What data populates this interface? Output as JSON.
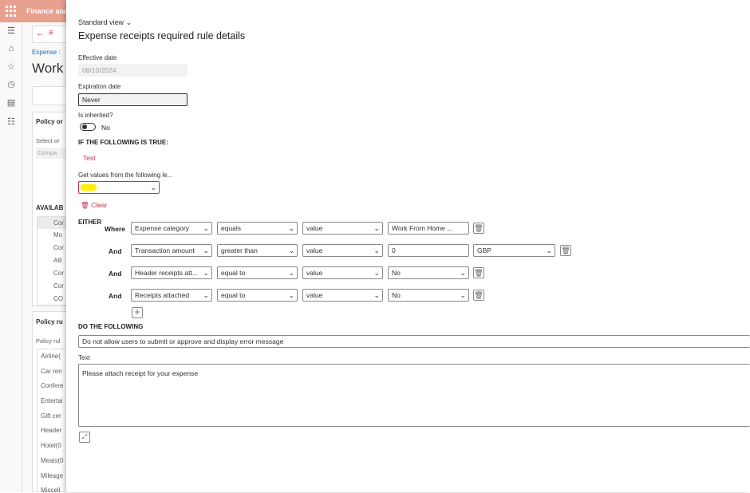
{
  "app": {
    "title": "Finance and"
  },
  "background": {
    "breadcrumb": "Expense :",
    "heading": "Work",
    "policy_org_label": "Policy or",
    "select_label": "Select or",
    "company_label": "Compa",
    "available_label": "AVAILAB",
    "available_items": [
      "Cor",
      "Mo",
      "Cor",
      "Alli",
      "Cor",
      "Cor",
      "CO"
    ],
    "policy_rules_label": "Policy ru",
    "policy_rules_sub": "Policy rul",
    "rule_items": [
      "Airline(",
      "Car ren",
      "Confere",
      "Entertai",
      "Gift cer",
      "Header",
      "Hotel(0",
      "Meals(0",
      "Mileage",
      "Miscell"
    ]
  },
  "panel": {
    "view": "Standard view",
    "title": "Expense receipts required rule details",
    "effective_date": {
      "label": "Effective date",
      "value": "08/10/2024"
    },
    "expiration_date": {
      "label": "Expiration date",
      "value": "Never"
    },
    "is_inherited": {
      "label": "Is inherited?",
      "value": "No"
    },
    "if_heading": "IF THE FOLLOWING IS TRUE:",
    "test_link": "Test",
    "get_values_label": "Get values from the following le...",
    "clear_label": "Clear",
    "either_label": "EITHER",
    "conditions": [
      {
        "conn": "Where",
        "field": "Expense category",
        "op": "equals",
        "type": "value",
        "val": "Work From Home ..."
      },
      {
        "conn": "And",
        "field": "Transaction amount",
        "op": "greater than",
        "type": "value",
        "val": "0",
        "extra": "GBP"
      },
      {
        "conn": "And",
        "field": "Header receipts att...",
        "op": "equal to",
        "type": "value",
        "val": "No"
      },
      {
        "conn": "And",
        "field": "Receipts attached",
        "op": "equal to",
        "type": "value",
        "val": "No"
      }
    ],
    "do_heading": "DO THE FOLLOWING",
    "action": "Do not allow users to submit or approve and display error message",
    "text_label": "Text",
    "text_value": "Please attach receipt for your expense"
  },
  "colors": {
    "accent": "#c4314b",
    "topbar": "#e8a08f",
    "highlight": "#ffef00"
  }
}
